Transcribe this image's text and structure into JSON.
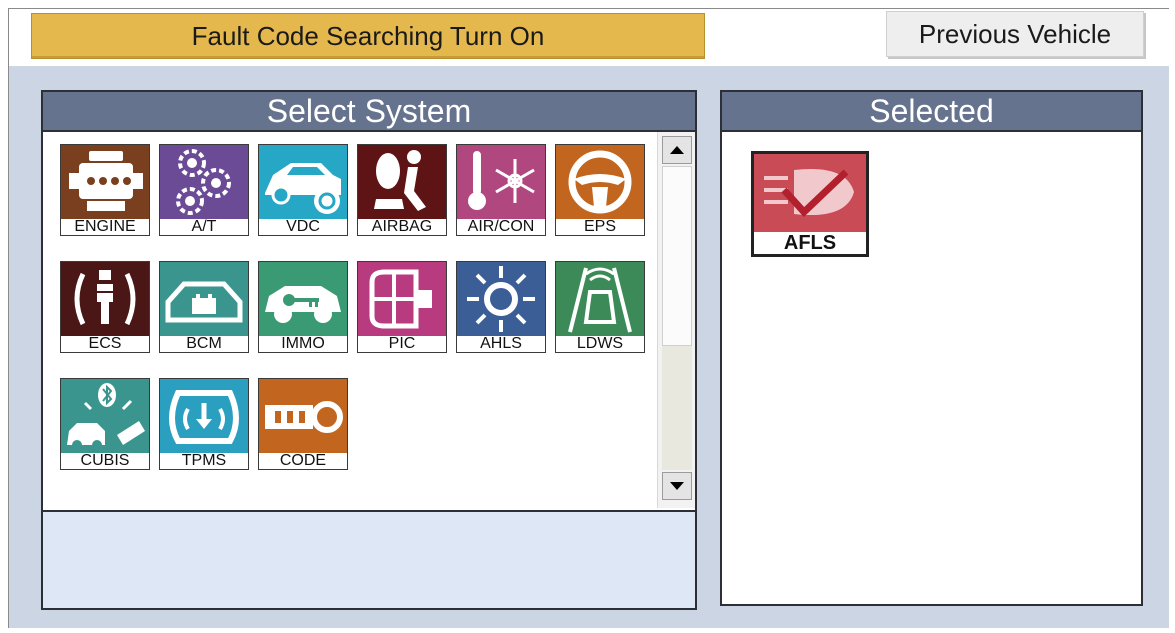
{
  "toolbar": {
    "fault_label": "Fault Code Searching Turn On",
    "prev_label": "Previous Vehicle"
  },
  "select_panel": {
    "title": "Select System",
    "systems": [
      {
        "label": "ENGINE",
        "icon": "engine-icon",
        "color": "#7a3f1f"
      },
      {
        "label": "A/T",
        "icon": "gears-icon",
        "color": "#6b4a96"
      },
      {
        "label": "VDC",
        "icon": "car-wheel-icon",
        "color": "#27a7c6"
      },
      {
        "label": "AIRBAG",
        "icon": "airbag-icon",
        "color": "#5e1414"
      },
      {
        "label": "AIR/CON",
        "icon": "thermometer-snowflake-icon",
        "color": "#b0487f"
      },
      {
        "label": "EPS",
        "icon": "steering-wheel-icon",
        "color": "#c2661f"
      },
      {
        "label": "ECS",
        "icon": "suspension-icon",
        "color": "#4a1616"
      },
      {
        "label": "BCM",
        "icon": "car-battery-icon",
        "color": "#3a958f"
      },
      {
        "label": "IMMO",
        "icon": "car-key-icon",
        "color": "#3a9a73"
      },
      {
        "label": "PIC",
        "icon": "smart-key-icon",
        "color": "#b83b80"
      },
      {
        "label": "AHLS",
        "icon": "headlight-sun-icon",
        "color": "#3c5e96"
      },
      {
        "label": "LDWS",
        "icon": "lane-departure-icon",
        "color": "#3c8a58"
      },
      {
        "label": "CUBIS",
        "icon": "bluetooth-car-icon",
        "color": "#3a958f"
      },
      {
        "label": "TPMS",
        "icon": "tire-pressure-icon",
        "color": "#2a9fc0"
      },
      {
        "label": "CODE",
        "icon": "key-code-icon",
        "color": "#c2661f"
      }
    ]
  },
  "selected_panel": {
    "title": "Selected",
    "items": [
      {
        "label": "AFLS",
        "icon": "adaptive-headlight-icon",
        "color": "#c84b55"
      }
    ]
  }
}
